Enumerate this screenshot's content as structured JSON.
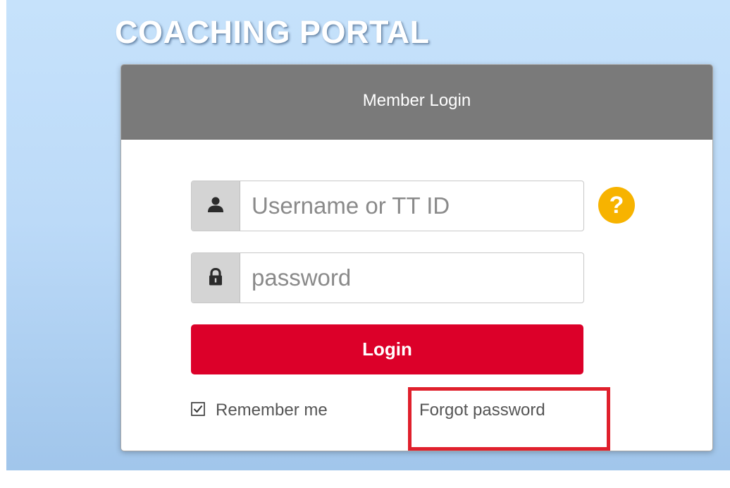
{
  "page": {
    "title": "COACHING PORTAL"
  },
  "login_card": {
    "header_title": "Member Login",
    "username": {
      "placeholder": "Username or TT ID",
      "value": "",
      "icon": "user-icon"
    },
    "password": {
      "placeholder": "password",
      "value": "",
      "icon": "lock-icon"
    },
    "help": {
      "icon": "help-icon",
      "glyph": "?"
    },
    "login_button_label": "Login",
    "remember_me": {
      "label": "Remember me",
      "checked": true
    },
    "forgot_password_label": "Forgot password"
  },
  "colors": {
    "header_bg": "#7a7a7a",
    "login_button": "#dc0029",
    "help_icon": "#f7b300",
    "highlight": "#e0202c",
    "background": "#bcdaf8"
  }
}
